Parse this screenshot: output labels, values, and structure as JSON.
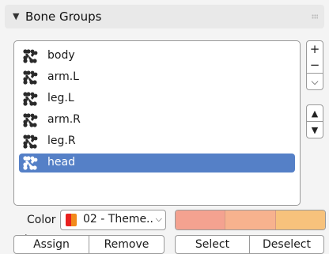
{
  "panel": {
    "title": "Bone Groups"
  },
  "bone_groups": [
    {
      "label": "body",
      "selected": false
    },
    {
      "label": "arm.L",
      "selected": false
    },
    {
      "label": "leg.L",
      "selected": false
    },
    {
      "label": "arm.R",
      "selected": false
    },
    {
      "label": "leg.R",
      "selected": false
    },
    {
      "label": "head",
      "selected": true
    }
  ],
  "side_buttons": {
    "add": "+",
    "remove": "−",
    "menu": "⌵",
    "up": "▲",
    "down": "▼"
  },
  "color": {
    "label": "Color",
    "selected": "02 - Theme..",
    "swatches": [
      "#f4a290",
      "#f7b28e",
      "#f7c27c"
    ]
  },
  "actions": {
    "assign": "Assign",
    "remove": "Remove",
    "select": "Select",
    "deselect": "Deselect"
  },
  "colors": {
    "selection": "#5580c7",
    "icon": "#2a2a2a"
  }
}
